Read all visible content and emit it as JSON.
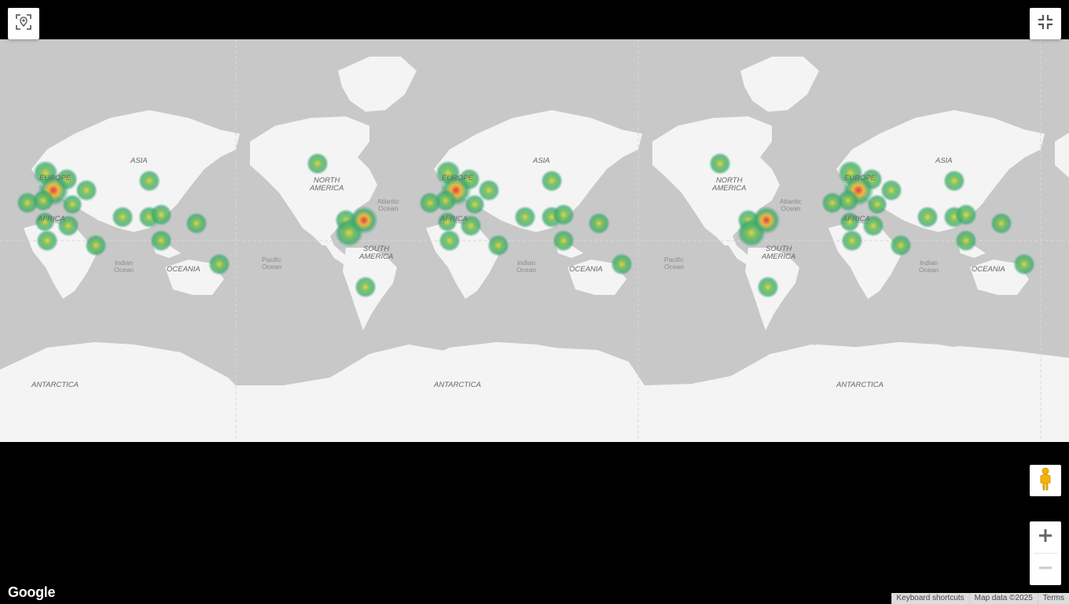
{
  "controls": {
    "locate_icon": "location-target-icon",
    "fullscreen_icon": "exit-fullscreen-icon",
    "pegman_icon": "street-view-pegman-icon",
    "zoom_in_icon": "plus-icon",
    "zoom_out_icon": "minus-icon"
  },
  "logo": "Google",
  "attribution": {
    "shortcuts": "Keyboard shortcuts",
    "map_data": "Map data ©2025",
    "terms": "Terms"
  },
  "labels": {
    "asia": "ASIA",
    "europe": "EUROPE",
    "africa": "AFRICA",
    "oceania": "OCEANIA",
    "antarctica": "ANTARCTICA",
    "north_america_1": "NORTH",
    "north_america_2": "AMERICA",
    "south_america_1": "SOUTH",
    "south_america_2": "AMERICA",
    "indian_1": "Indian",
    "indian_2": "Ocean",
    "pacific_1": "Pacific",
    "pacific_2": "Ocean",
    "atlantic_1": "Atlantic",
    "atlantic_2": "Ocean"
  },
  "colors": {
    "land": "#f4f4f4",
    "water": "#c8c8c8",
    "heat_low": "#3aa76d",
    "heat_mid": "#e8d23a",
    "heat_high": "#e2384a"
  }
}
